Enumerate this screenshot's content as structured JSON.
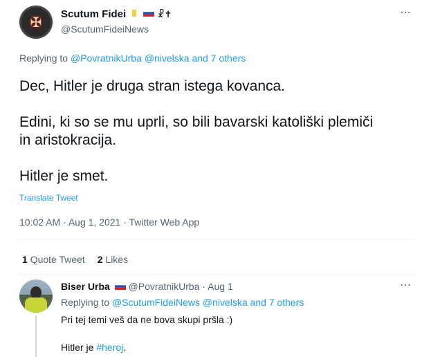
{
  "main_tweet": {
    "author_name": "Scutum Fidei",
    "author_handle": "@ScutumFideiNews",
    "name_suffix": "☧✝",
    "replying_label": "Replying to",
    "replying_handles": "@PovratnikUrba @nivelska",
    "replying_others": "and 7 others",
    "line1": "Dec, Hitler je druga stran istega kovanca.",
    "line2a": "Edini, ki so se mu uprli, so bili bavarski katoliški plemiči",
    "line2b": "in aristokracija.",
    "line3": "Hitler je smet.",
    "translate": "Translate Tweet",
    "timestamp": "10:02 AM · Aug 1, 2021 · Twitter Web App",
    "quote_count": "1",
    "quote_label": "Quote Tweet",
    "likes_count": "2",
    "likes_label": "Likes"
  },
  "reply_tweet": {
    "author_name": "Biser Urba",
    "meta": "@PovratnikUrba · Aug 1",
    "replying_label": "Replying to",
    "replying_handles": "@ScutumFideiNews @nivelska",
    "replying_others": "and 7 others",
    "line1": "Pri tej temi veš da ne bova skupi pršla :)",
    "line2_prefix": "Hitler je",
    "hashtag": "#heroj",
    "line2_suffix": "."
  },
  "icons": {
    "more": "⋯",
    "vatican_flag": "vatican-flag-icon",
    "slovenia_flag": "slovenia-flag-icon"
  },
  "colors": {
    "link": "#1d9bf0",
    "secondary": "#536471",
    "text": "#0f1419"
  }
}
